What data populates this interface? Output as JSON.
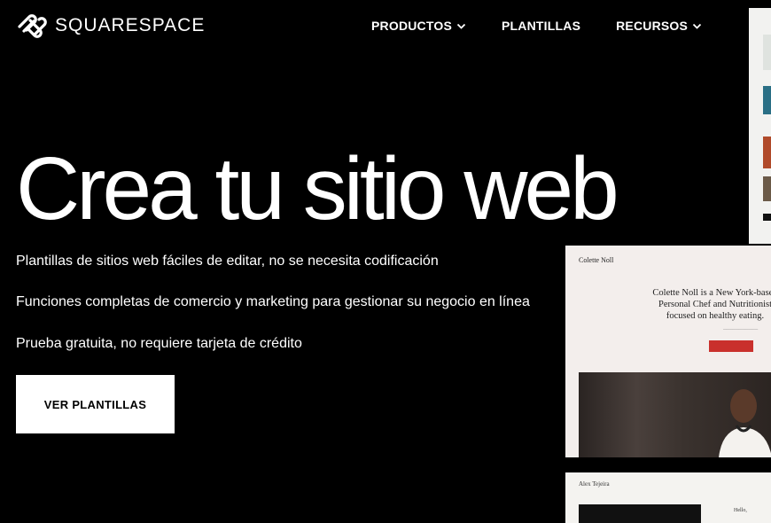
{
  "header": {
    "brand": "SQUARESPACE",
    "nav": [
      {
        "label": "PRODUCTOS",
        "has_dropdown": true
      },
      {
        "label": "PLANTILLAS",
        "has_dropdown": false
      },
      {
        "label": "RECURSOS",
        "has_dropdown": true
      }
    ]
  },
  "hero": {
    "title": "Crea tu sitio web",
    "features": [
      "Plantillas de sitios web fáciles de editar, no se necesita codificación",
      "Funciones completas de comercio y marketing para gestionar su negocio en línea",
      "Prueba gratuita, no requiere tarjeta de crédito"
    ],
    "cta_label": "VER PLANTILLAS"
  },
  "previews": {
    "main": {
      "brand": "Colette Noll",
      "headline": "Colette Noll is a New York-based Personal Chef and Nutritionist focused on healthy eating."
    },
    "bottom": {
      "brand": "Alex Tejeira",
      "greeting": "Hello,"
    }
  },
  "colors": {
    "background": "#000000",
    "text": "#ffffff",
    "cta_bg": "#ffffff",
    "cta_text": "#000000",
    "preview_accent": "#c9302c"
  },
  "icons": {
    "logo": "squarespace-logo-icon",
    "dropdown": "chevron-down-icon"
  }
}
